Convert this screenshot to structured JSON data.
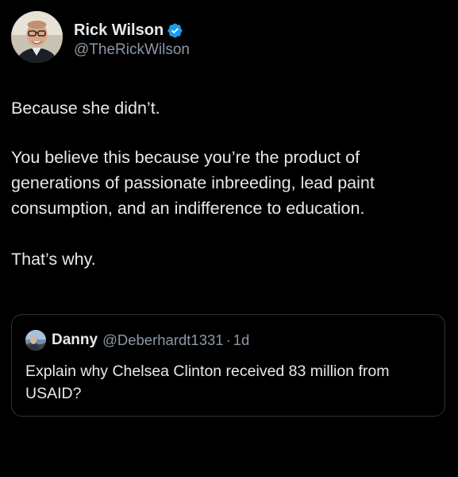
{
  "tweet": {
    "author": {
      "display_name": "Rick Wilson",
      "handle": "@TheRickWilson",
      "verified": true,
      "avatar_icon": "profile-photo",
      "verified_icon": "verified-badge-icon",
      "verified_color": "#1d9bf0"
    },
    "paragraphs": [
      "Because she didn’t.",
      "You believe this because you’re the product of generations of passionate inbreeding, lead paint consumption, and an indifference to education.",
      "That’s why."
    ],
    "quoted": {
      "display_name": "Danny",
      "handle": "@Deberhardt1331",
      "separator": "·",
      "time": "1d",
      "avatar_icon": "profile-photo",
      "text": "Explain why Chelsea Clinton received 83 million from USAID?"
    }
  },
  "colors": {
    "background": "#000000",
    "text_primary": "#e7e9ea",
    "text_secondary": "#8b98a5",
    "border": "#2f3336"
  }
}
